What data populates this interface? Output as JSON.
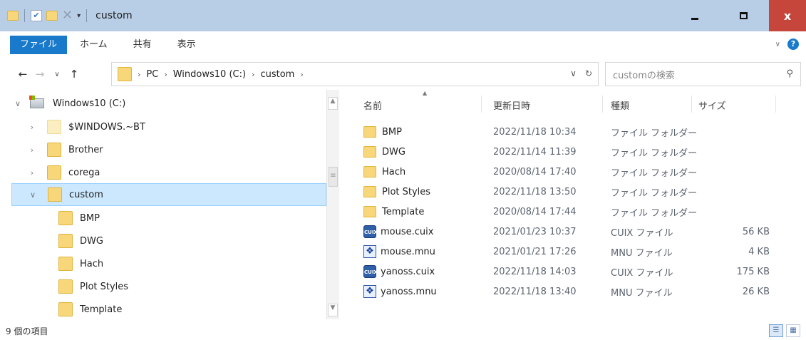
{
  "window": {
    "title": "custom",
    "buttons": {
      "minimize": "minimize",
      "maximize": "maximize",
      "close": "x"
    }
  },
  "ribbon": {
    "tabs": [
      "ファイル",
      "ホーム",
      "共有",
      "表示"
    ]
  },
  "address": {
    "crumbs": [
      "PC",
      "Windows10 (C:)",
      "custom"
    ],
    "search_placeholder": "customの検索"
  },
  "nav": {
    "items": [
      {
        "label": "Windows10 (C:)",
        "icon": "drive-icon"
      },
      {
        "label": "$WINDOWS.~BT",
        "icon": "folder-icon"
      },
      {
        "label": "Brother",
        "icon": "folder-icon"
      },
      {
        "label": "corega",
        "icon": "folder-icon"
      },
      {
        "label": "custom",
        "icon": "folder-icon",
        "selected": true
      },
      {
        "label": "BMP",
        "icon": "folder-icon"
      },
      {
        "label": "DWG",
        "icon": "folder-icon"
      },
      {
        "label": "Hach",
        "icon": "folder-icon"
      },
      {
        "label": "Plot Styles",
        "icon": "folder-icon"
      },
      {
        "label": "Template",
        "icon": "folder-icon"
      }
    ]
  },
  "list": {
    "headers": {
      "name": "名前",
      "date": "更新日時",
      "type": "種類",
      "size": "サイズ"
    },
    "rows": [
      {
        "name": "BMP",
        "date": "2022/11/18 10:34",
        "type": "ファイル フォルダー",
        "size": "",
        "icon": "folder-icon"
      },
      {
        "name": "DWG",
        "date": "2022/11/14 11:39",
        "type": "ファイル フォルダー",
        "size": "",
        "icon": "folder-icon"
      },
      {
        "name": "Hach",
        "date": "2020/08/14 17:40",
        "type": "ファイル フォルダー",
        "size": "",
        "icon": "folder-icon"
      },
      {
        "name": "Plot Styles",
        "date": "2022/11/18 13:50",
        "type": "ファイル フォルダー",
        "size": "",
        "icon": "folder-icon"
      },
      {
        "name": "Template",
        "date": "2020/08/14 17:44",
        "type": "ファイル フォルダー",
        "size": "",
        "icon": "folder-icon"
      },
      {
        "name": "mouse.cuix",
        "date": "2021/01/23 10:37",
        "type": "CUIX ファイル",
        "size": "56 KB",
        "icon": "cuix-file-icon"
      },
      {
        "name": "mouse.mnu",
        "date": "2021/01/21 17:26",
        "type": "MNU ファイル",
        "size": "4 KB",
        "icon": "mnu-file-icon"
      },
      {
        "name": "yanoss.cuix",
        "date": "2022/11/18 14:03",
        "type": "CUIX ファイル",
        "size": "175 KB",
        "icon": "cuix-file-icon"
      },
      {
        "name": "yanoss.mnu",
        "date": "2022/11/18 13:40",
        "type": "MNU ファイル",
        "size": "26 KB",
        "icon": "mnu-file-icon"
      }
    ]
  },
  "status": {
    "text": "9 個の項目"
  },
  "colors": {
    "titlebar": "#b8cde6",
    "file_tab": "#1979ca",
    "close": "#c6463b",
    "selection": "#cce8ff"
  }
}
